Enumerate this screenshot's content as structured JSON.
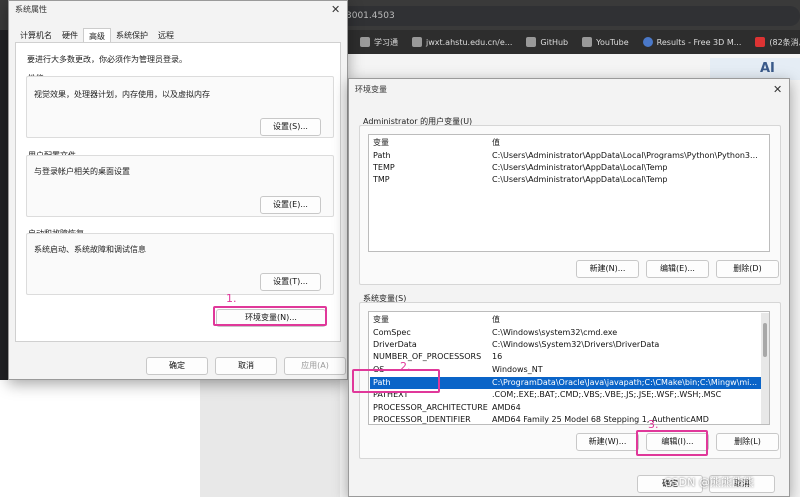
{
  "browser": {
    "url_fragment": "3001.4503",
    "bookmarks": [
      {
        "label": "学习通",
        "icon": "globe-icon"
      },
      {
        "label": "jwxt.ahstu.edu.cn/e...",
        "icon": "page-icon"
      },
      {
        "label": "GitHub",
        "icon": "github-icon"
      },
      {
        "label": "YouTube",
        "icon": "page-icon"
      },
      {
        "label": "Results - Free 3D M...",
        "icon": "globe-icon"
      },
      {
        "label": "(82条消息) 双目",
        "icon": "csdn-icon"
      }
    ],
    "banner_text": "AI"
  },
  "system_properties": {
    "title": "系统属性",
    "tabs": [
      "计算机名",
      "硬件",
      "高级",
      "系统保护",
      "远程"
    ],
    "active_tab": "高级",
    "admin_note": "要进行大多数更改，你必须作为管理员登录。",
    "performance": {
      "label": "性能",
      "desc": "视觉效果，处理器计划，内存使用，以及虚拟内存",
      "button": "设置(S)..."
    },
    "user_profiles": {
      "label": "用户配置文件",
      "desc": "与登录帐户相关的桌面设置",
      "button": "设置(E)..."
    },
    "startup_recovery": {
      "label": "启动和故障恢复",
      "desc": "系统启动、系统故障和调试信息",
      "button": "设置(T)..."
    },
    "env_button": "环境变量(N)...",
    "ok": "确定",
    "cancel": "取消",
    "apply": "应用(A)"
  },
  "env_vars": {
    "title": "环境变量",
    "user_group_label": "Administrator 的用户变量(U)",
    "user_headers": [
      "变量",
      "值"
    ],
    "user_rows": [
      [
        "Path",
        "C:\\Users\\Administrator\\AppData\\Local\\Programs\\Python\\Python3..."
      ],
      [
        "TEMP",
        "C:\\Users\\Administrator\\AppData\\Local\\Temp"
      ],
      [
        "TMP",
        "C:\\Users\\Administrator\\AppData\\Local\\Temp"
      ]
    ],
    "user_buttons": [
      "新建(N)...",
      "编辑(E)...",
      "删除(D)"
    ],
    "sys_group_label": "系统变量(S)",
    "sys_headers": [
      "变量",
      "值"
    ],
    "sys_rows": [
      [
        "ComSpec",
        "C:\\Windows\\system32\\cmd.exe"
      ],
      [
        "DriverData",
        "C:\\Windows\\System32\\Drivers\\DriverData"
      ],
      [
        "NUMBER_OF_PROCESSORS",
        "16"
      ],
      [
        "OS",
        "Windows_NT"
      ],
      [
        "Path",
        "C:\\ProgramData\\Oracle\\Java\\javapath;C:\\CMake\\bin;C:\\Mingw\\mi..."
      ],
      [
        "PATHEXT",
        ".COM;.EXE;.BAT;.CMD;.VBS;.VBE;.JS;.JSE;.WSF;.WSH;.MSC"
      ],
      [
        "PROCESSOR_ARCHITECTURE",
        "AMD64"
      ],
      [
        "PROCESSOR_IDENTIFIER",
        "AMD64 Family 25 Model 68 Stepping 1, AuthenticAMD"
      ]
    ],
    "sys_buttons": [
      "新建(W)...",
      "编辑(I)...",
      "删除(L)"
    ],
    "ok": "确定",
    "cancel": "取消"
  },
  "annotations": [
    "1.",
    "2.",
    "3."
  ],
  "watermark": "CSDN @熊熊熊熊",
  "colors": {
    "selection": "#0a64c8",
    "annotation": "#e0389a"
  }
}
